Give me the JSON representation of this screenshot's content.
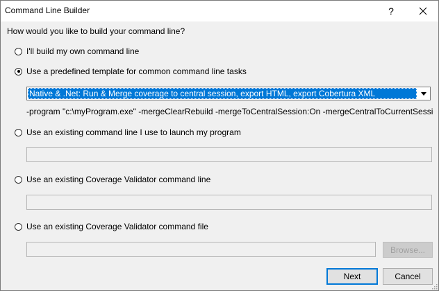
{
  "window": {
    "title": "Command Line Builder",
    "help_glyph": "?"
  },
  "prompt": "How would you like to build your command line?",
  "options": [
    {
      "label": "I'll build my own command line",
      "selected": false
    },
    {
      "label": "Use a predefined template for common command line tasks",
      "selected": true
    },
    {
      "label": "Use an existing command line I use to launch my program",
      "selected": false
    },
    {
      "label": "Use an existing Coverage Validator command line",
      "selected": false
    },
    {
      "label": "Use an existing Coverage Validator command file",
      "selected": false
    }
  ],
  "template_select": {
    "value": "Native & .Net: Run & Merge coverage to central session, export HTML, export Cobertura XML"
  },
  "command_preview": "-program \"c:\\myProgram.exe\" -mergeClearRebuild -mergeToCentralSession:On -mergeCentralToCurrentSession:On -ce...",
  "launch_command_field": {
    "value": ""
  },
  "cv_command_field": {
    "value": ""
  },
  "cv_command_file_field": {
    "value": ""
  },
  "buttons": {
    "browse": "Browse...",
    "next": "Next",
    "cancel": "Cancel"
  },
  "colors": {
    "selection": "#0078d7",
    "window_bg": "#f0f0f0"
  }
}
